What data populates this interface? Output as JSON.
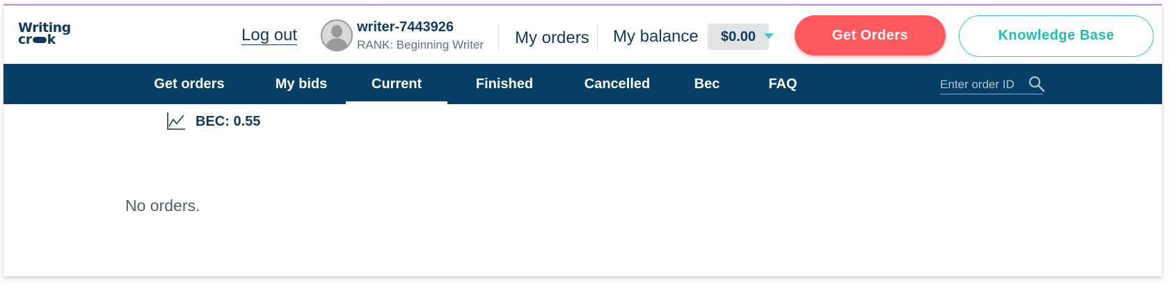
{
  "logo": {
    "line1": "Writing",
    "line2a": "cr",
    "line2b": "k"
  },
  "header": {
    "logout_label": "Log out",
    "username": "writer-7443926",
    "rank": "RANK: Beginning Writer",
    "my_orders_label": "My orders",
    "balance_label": "My balance",
    "balance_value": "$0.00",
    "get_orders_label": "Get Orders",
    "knowledge_base_label": "Knowledge Base"
  },
  "nav": {
    "items": [
      {
        "label": "Get orders"
      },
      {
        "label": "My bids"
      },
      {
        "label": "Current"
      },
      {
        "label": "Finished"
      },
      {
        "label": "Cancelled"
      },
      {
        "label": "Bec"
      },
      {
        "label": "FAQ"
      }
    ],
    "active_index": 2,
    "search_placeholder": "Enter order ID"
  },
  "content": {
    "bec_label": "BEC: 0.55",
    "empty_message": "No orders."
  },
  "colors": {
    "nav_bg": "#053f66",
    "primary_text": "#13395e",
    "get_orders_btn": "#ff5a5f",
    "accent_teal": "#3cc8c0",
    "frame_top_border": "#b48ad9"
  }
}
